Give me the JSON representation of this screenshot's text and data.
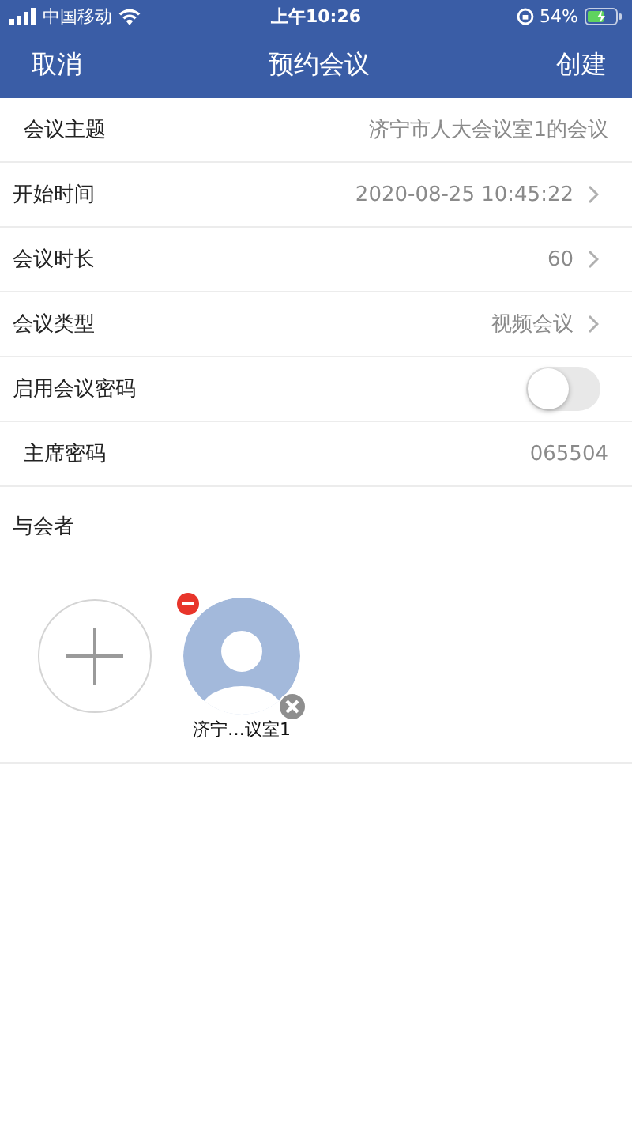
{
  "status_bar": {
    "carrier": "中国移动",
    "time": "上午10:26",
    "battery": "54%"
  },
  "nav_bar": {
    "left": "取消",
    "title": "预约会议",
    "right": "创建"
  },
  "rows": [
    {
      "kind": "text",
      "label": "会议主题",
      "value": "济宁市人大会议室1的会议"
    },
    {
      "kind": "select",
      "label": "开始时间",
      "value": "2020-08-25 10:45:22"
    },
    {
      "kind": "select",
      "label": "会议时长",
      "value": "60"
    },
    {
      "kind": "select",
      "label": "会议类型",
      "value": "视频会议"
    },
    {
      "kind": "toggle",
      "label": "启用会议密码",
      "on": false
    },
    {
      "kind": "text",
      "label": "主席密码",
      "value": "065504"
    }
  ],
  "attendees": {
    "title": "与会者",
    "members": [
      {
        "name": "济宁…议室1"
      }
    ]
  }
}
